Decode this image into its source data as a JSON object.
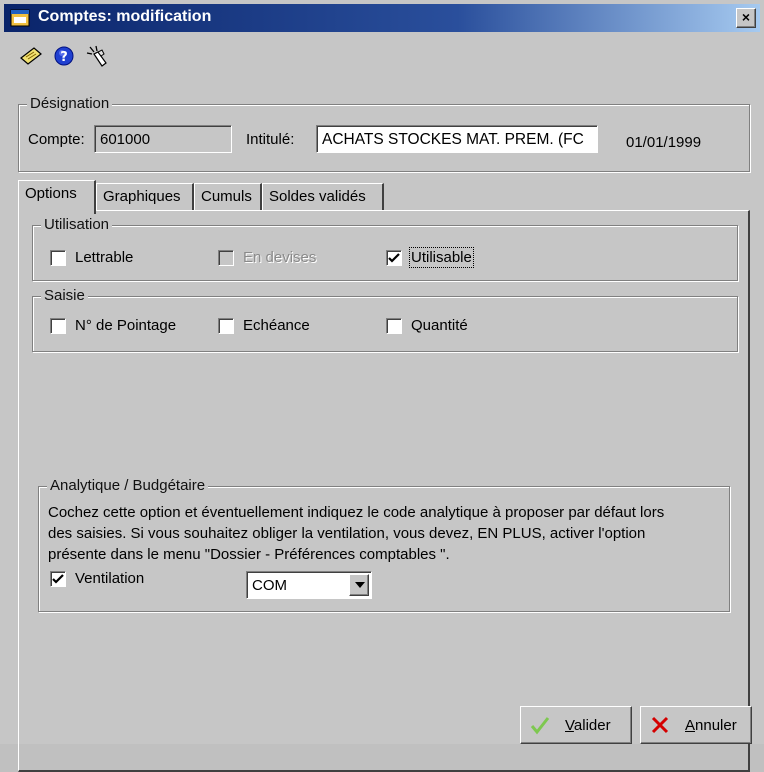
{
  "window": {
    "title": "Comptes: modification",
    "close_symbol": "×",
    "accent": "#0a246a"
  },
  "toolbar": {
    "icons": [
      "note-icon",
      "help-icon",
      "magic-icon"
    ]
  },
  "designation": {
    "legend": "Désignation",
    "compte_label": "Compte:",
    "compte_value": "601000",
    "intitule_label": "Intitulé:",
    "intitule_value": "ACHATS STOCKES MAT. PREM. (FC",
    "date": "01/01/1999"
  },
  "tabs": [
    {
      "label": "Options",
      "active": true
    },
    {
      "label": "Graphiques",
      "active": false
    },
    {
      "label": "Cumuls",
      "active": false
    },
    {
      "label": "Soldes validés",
      "active": false
    }
  ],
  "utilisation": {
    "legend": "Utilisation",
    "items": [
      {
        "label": "Lettrable",
        "checked": false,
        "enabled": true
      },
      {
        "label": "En devises",
        "checked": false,
        "enabled": false
      },
      {
        "label": "Utilisable",
        "checked": true,
        "enabled": true
      }
    ]
  },
  "saisie": {
    "legend": "Saisie",
    "items": [
      {
        "label": "N° de Pointage",
        "checked": false
      },
      {
        "label": "Echéance",
        "checked": false
      },
      {
        "label": "Quantité",
        "checked": false
      }
    ]
  },
  "analytique": {
    "legend": "Analytique / Budgétaire",
    "description_lines": [
      "Cochez cette option et éventuellement indiquez le code analytique à proposer par défaut lors",
      "des saisies. Si vous souhaitez obliger la ventilation, vous devez, EN PLUS, activer l'option",
      "présente dans le menu \"Dossier - Préférences comptables \"."
    ],
    "ventilation_label": "Ventilation",
    "ventilation_checked": true,
    "code_value": "COM"
  },
  "buttons": {
    "valider_mnemonic": "V",
    "valider_rest": "alider",
    "annuler_mnemonic": "A",
    "annuler_rest": "nnuler",
    "valider_icon_color": "#7ec850",
    "annuler_icon_color": "#d40000"
  }
}
